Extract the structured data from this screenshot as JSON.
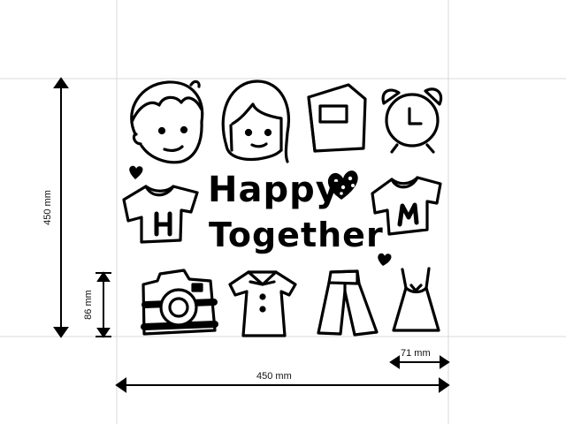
{
  "design": {
    "title_line1": "Happy",
    "title_line2": "Together"
  },
  "dimensions": {
    "height_label": "450 mm",
    "width_label": "450 mm",
    "small_height_label": "86 mm",
    "small_width_label": "71 mm"
  },
  "icons": [
    "boy-face-icon",
    "girl-face-icon",
    "book-icon",
    "alarm-clock-icon",
    "shirt-h-icon",
    "heart-icon",
    "polka-heart-icon",
    "shirt-m-icon",
    "camera-icon",
    "blouse-icon",
    "pants-icon",
    "dress-icon"
  ],
  "colors": {
    "ink": "#000000",
    "guide": "#d9d9d9"
  }
}
